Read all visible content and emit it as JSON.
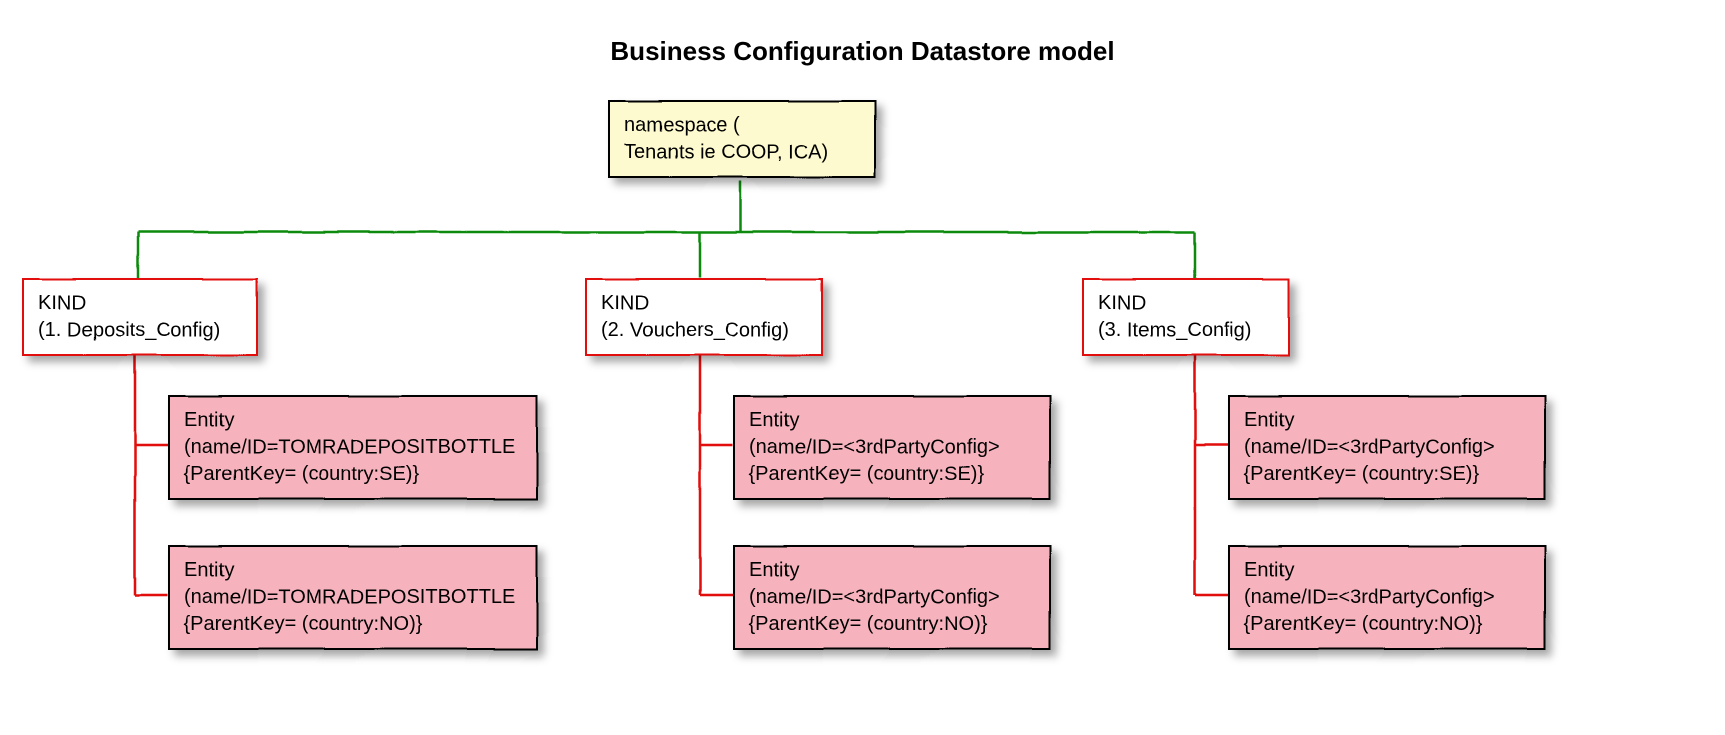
{
  "title": "Business Configuration Datastore model",
  "namespace": {
    "line1": "namespace (",
    "line2": "Tenants ie COOP, ICA)"
  },
  "kinds": [
    {
      "line1": "KIND",
      "line2": "(1. Deposits_Config)",
      "entities": [
        {
          "l1": "Entity",
          "l2": "(name/ID=TOMRADEPOSITBOTTLE",
          "l3": "{ParentKey= (country:SE)}"
        },
        {
          "l1": "Entity",
          "l2": "(name/ID=TOMRADEPOSITBOTTLE",
          "l3": "{ParentKey= (country:NO)}"
        }
      ]
    },
    {
      "line1": "KIND",
      "line2": "(2. Vouchers_Config)",
      "entities": [
        {
          "l1": "Entity",
          "l2": "(name/ID=<3rdPartyConfig>",
          "l3": "{ParentKey= (country:SE)}"
        },
        {
          "l1": "Entity",
          "l2": "(name/ID=<3rdPartyConfig>",
          "l3": "{ParentKey= (country:NO)}"
        }
      ]
    },
    {
      "line1": "KIND",
      "line2": "(3. Items_Config)",
      "entities": [
        {
          "l1": "Entity",
          "l2": "(name/ID=<3rdPartyConfig>",
          "l3": "{ParentKey= (country:SE)}"
        },
        {
          "l1": "Entity",
          "l2": "(name/ID=<3rdPartyConfig>",
          "l3": "{ParentKey= (country:NO)}"
        }
      ]
    }
  ]
}
